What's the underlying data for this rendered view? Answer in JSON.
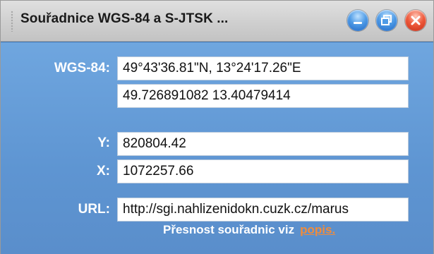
{
  "window": {
    "title": "Souřadnice WGS-84 a S-JTSK ...",
    "buttons": {
      "minimize_icon": "minimize-icon",
      "maximize_icon": "restore-icon",
      "close_icon": "close-icon"
    }
  },
  "form": {
    "wgs_label": "WGS-84:",
    "wgs_dms": "49°43'36.81\"N, 13°24'17.26\"E",
    "wgs_decimal": "49.726891082 13.40479414",
    "y_label": "Y:",
    "y_value": "820804.42",
    "x_label": "X:",
    "x_value": "1072257.66",
    "url_label": "URL:",
    "url_value": "http://sgi.nahlizenidokn.cuzk.cz/marus"
  },
  "note": {
    "text": "Přesnost souřadnic viz",
    "link": "popis."
  },
  "colors": {
    "panel": "#5e95d2",
    "link": "#f08c3c",
    "label": "#ffffff"
  }
}
